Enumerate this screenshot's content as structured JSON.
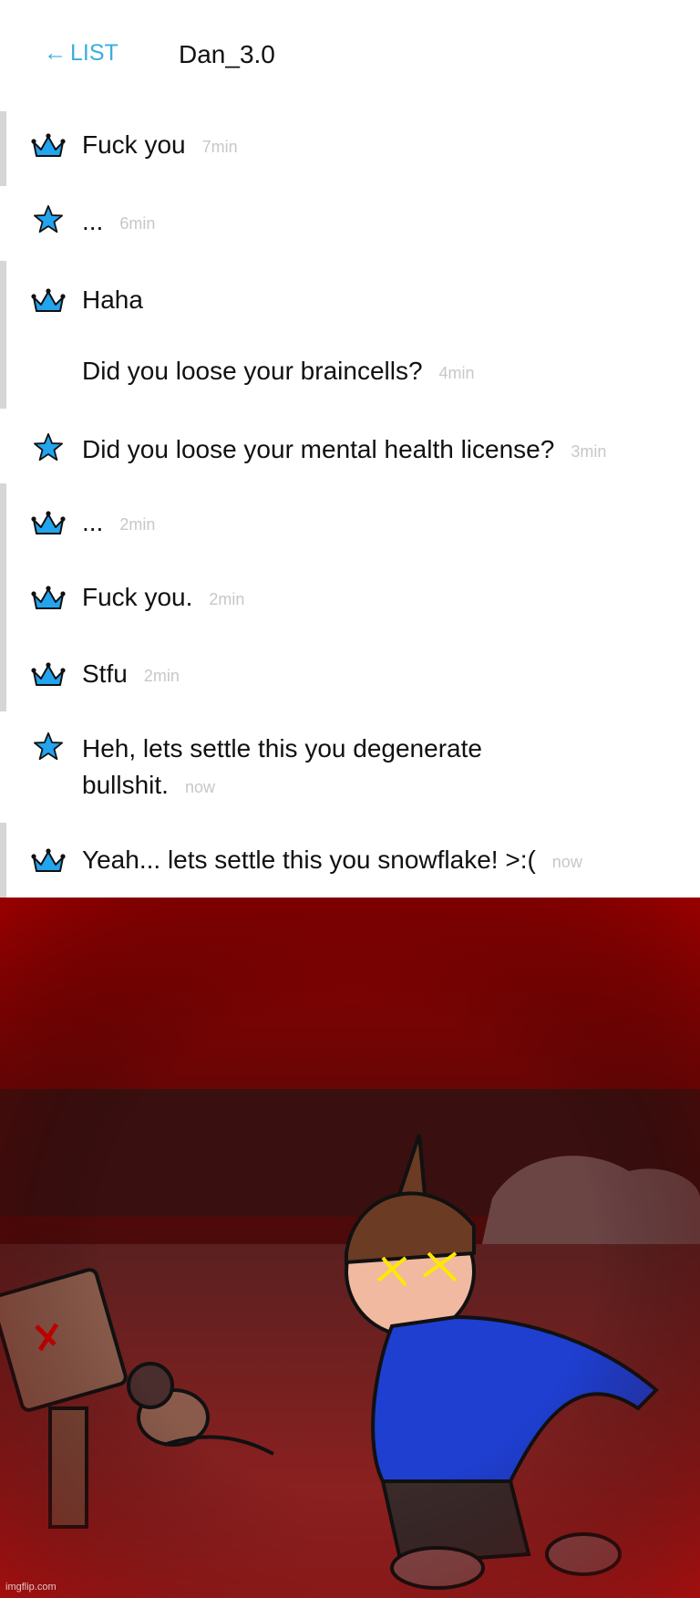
{
  "header": {
    "back_label": "LIST",
    "back_arrow": "←",
    "title": "Dan_3.0"
  },
  "icons": {
    "crown": "crown-icon",
    "star": "star-icon"
  },
  "colors": {
    "accent": "#3aaee0",
    "icon_blue": "#22a4ef",
    "time": "#c7c7c7",
    "bar": "#d6d6d6"
  },
  "messages": [
    {
      "sender": "crown",
      "text": "Fuck you",
      "time": "7min"
    },
    {
      "sender": "star",
      "text": "...",
      "time": "6min"
    },
    {
      "sender": "crown",
      "text": "Haha",
      "time": ""
    },
    {
      "sender": "crown",
      "text": "Did you loose your braincells?",
      "time": "4min"
    },
    {
      "sender": "star",
      "text": "Did you loose your mental health license?",
      "time": "3min"
    },
    {
      "sender": "crown",
      "text": "...",
      "time": "2min"
    },
    {
      "sender": "crown",
      "text": "Fuck you.",
      "time": "2min"
    },
    {
      "sender": "crown",
      "text": "Stfu",
      "time": "2min"
    },
    {
      "sender": "star",
      "text": "Heh, lets settle this you degenerate",
      "text2": "bullshit.",
      "time": "now"
    },
    {
      "sender": "crown",
      "text": "Yeah... lets settle this you snowflake! >:(",
      "time": "now"
    }
  ],
  "scene": {
    "watermark": "imgflip.com"
  }
}
